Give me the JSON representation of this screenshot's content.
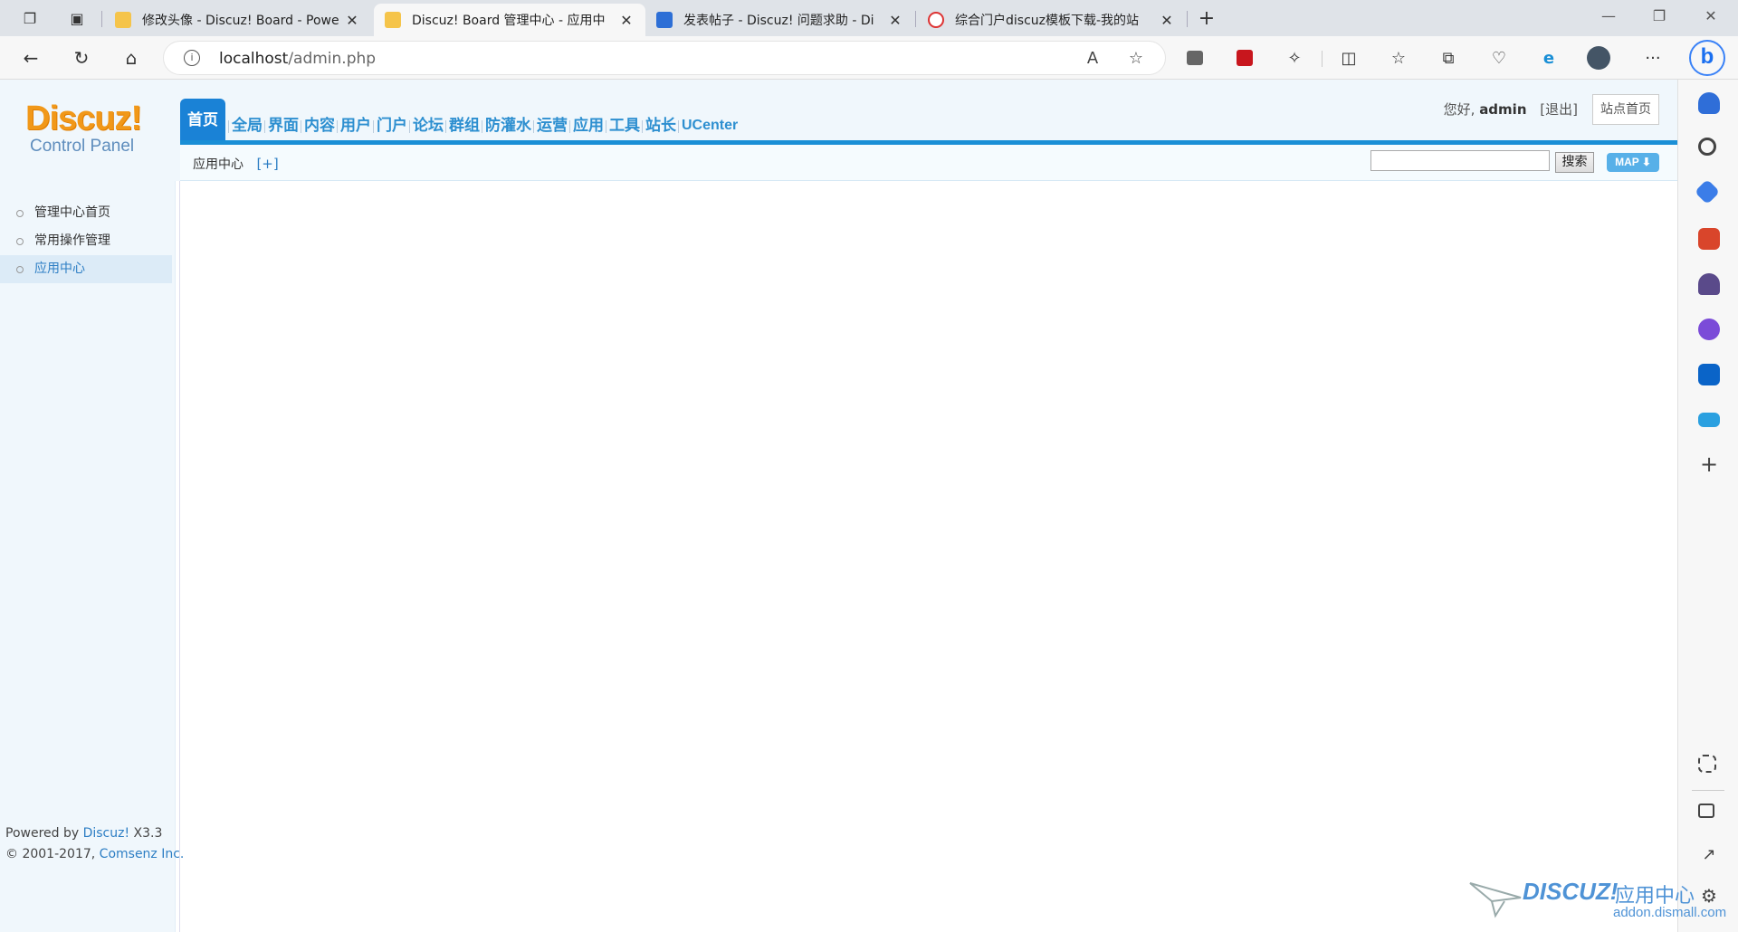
{
  "browser": {
    "tabs": [
      {
        "title": "修改头像 - Discuz! Board - Powe",
        "active": false
      },
      {
        "title": "Discuz! Board 管理中心 - 应用中",
        "active": true
      },
      {
        "title": "发表帖子 - Discuz! 问题求助 - Di",
        "active": false
      },
      {
        "title": "综合门户discuz模板下载-我的站",
        "active": false
      }
    ],
    "url_host": "localhost",
    "url_path": "/admin.php"
  },
  "header": {
    "logo_top": "Discuz!",
    "logo_bottom": "Control Panel",
    "nav": [
      "首页",
      "全局",
      "界面",
      "内容",
      "用户",
      "门户",
      "论坛",
      "群组",
      "防灌水",
      "运营",
      "应用",
      "工具",
      "站长",
      "UCenter"
    ],
    "greeting_prefix": "您好,",
    "username": "admin",
    "logout": "[退出]",
    "site_home": "站点首页"
  },
  "subbar": {
    "breadcrumb": "应用中心",
    "add_link": "[+]",
    "search_button": "搜索",
    "map_button": "MAP ⬇"
  },
  "sidebar": {
    "items": [
      {
        "label": "管理中心首页",
        "active": false
      },
      {
        "label": "常用操作管理",
        "active": false
      },
      {
        "label": "应用中心",
        "active": true
      }
    ],
    "powered_prefix": "Powered by ",
    "powered_link": "Discuz!",
    "powered_version": " X3.3",
    "copyright_prefix": "© 2001-2017, ",
    "copyright_link": "Comsenz Inc."
  },
  "watermark": {
    "brand": "DISCUZ!",
    "cn": "应用中心",
    "domain": "addon.dismall.com"
  },
  "colors": {
    "accent_blue": "#1a82d6",
    "logo_orange": "#f19819",
    "link_blue": "#2d7ec4"
  }
}
